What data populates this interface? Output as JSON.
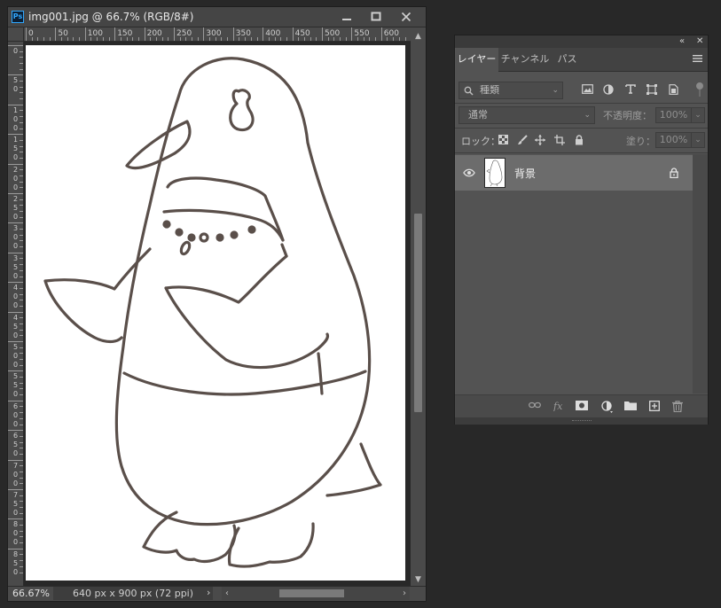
{
  "document_window": {
    "title": "img001.jpg @ 66.7% (RGB/8#)",
    "app_icon_text": "Ps",
    "controls": {
      "minimize": "minimize-icon",
      "maximize": "maximize-icon",
      "close": "close-icon"
    }
  },
  "rulers": {
    "horizontal_labels": [
      "0",
      "50",
      "100",
      "150",
      "200",
      "250",
      "300",
      "350",
      "400",
      "450",
      "500",
      "550",
      "600"
    ],
    "vertical_labels": [
      "0",
      "50",
      "100",
      "150",
      "200",
      "250",
      "300",
      "350",
      "400",
      "450",
      "500",
      "550",
      "600",
      "650",
      "700",
      "750",
      "800",
      "850"
    ]
  },
  "status_bar": {
    "zoom": "66.67%",
    "doc_info": "640 px x 900 px (72 ppi)",
    "more_arrow": "›"
  },
  "layers_panel": {
    "tabs": [
      {
        "label": "レイヤー",
        "active": true
      },
      {
        "label": "チャンネル",
        "active": false
      },
      {
        "label": "パス",
        "active": false
      }
    ],
    "filter_kind": "種類",
    "blend_mode": "通常",
    "opacity_label": "不透明度：",
    "opacity_value": "100%",
    "lock_label": "ロック：",
    "fill_label": "塗り：",
    "fill_value": "100%",
    "layers": [
      {
        "name": "背景",
        "visible": true,
        "locked": true
      }
    ]
  },
  "colors": {
    "app_bg": "#282828",
    "panel_bg": "#535353",
    "selected_layer": "#6c6c6c",
    "sketch_stroke": "#5a4f4a",
    "ps_blue": "#31a8ff"
  }
}
